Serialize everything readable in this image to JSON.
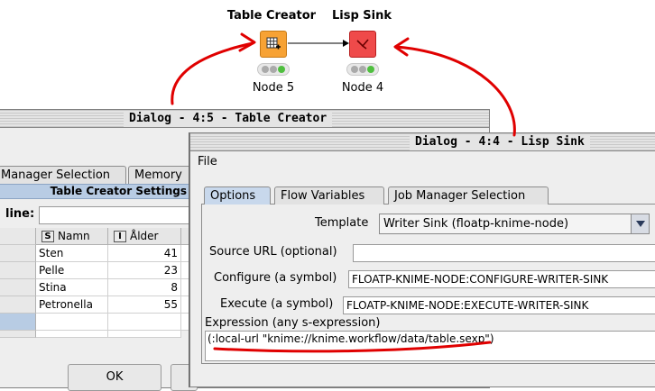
{
  "workflow": {
    "nodes": [
      {
        "title": "Table Creator",
        "label": "Node 5",
        "color": "#f7a234",
        "icon": "table-grid-icon"
      },
      {
        "title": "Lisp Sink",
        "label": "Node 4",
        "color": "#ef4a4a",
        "icon": "sink-arrow-icon"
      }
    ]
  },
  "table_creator_dialog": {
    "title": "Dialog - 4:5 - Table Creator",
    "tabs": [
      "Manager Selection",
      "Memory"
    ],
    "section_title": "Table Creator Settings",
    "line_label": "line:",
    "line_value": "",
    "columns": [
      {
        "type": "S",
        "name": "Namn"
      },
      {
        "type": "I",
        "name": "Ålder"
      }
    ],
    "rows": [
      {
        "name": "Sten",
        "age": "41"
      },
      {
        "name": "Pelle",
        "age": "23"
      },
      {
        "name": "Stina",
        "age": "8"
      },
      {
        "name": "Petronella",
        "age": "55"
      }
    ],
    "ok_label": "OK"
  },
  "lisp_sink_dialog": {
    "title": "Dialog - 4:4 - Lisp Sink",
    "menu_file": "File",
    "tabs": [
      "Options",
      "Flow Variables",
      "Job Manager Selection"
    ],
    "template_label": "Template",
    "template_value": "Writer Sink (floatp-knime-node)",
    "source_url_label": "Source URL (optional)",
    "source_url_value": "",
    "configure_label": "Configure (a symbol)",
    "configure_value": "FLOATP-KNIME-NODE:CONFIGURE-WRITER-SINK",
    "execute_label": "Execute (a symbol)",
    "execute_value": "FLOATP-KNIME-NODE:EXECUTE-WRITER-SINK",
    "expression_label": "Expression (any s-expression)",
    "expression_value": "(:local-url \"knime://knime.workflow/data/table.sexp\")"
  },
  "annotation_color": "#e00000"
}
